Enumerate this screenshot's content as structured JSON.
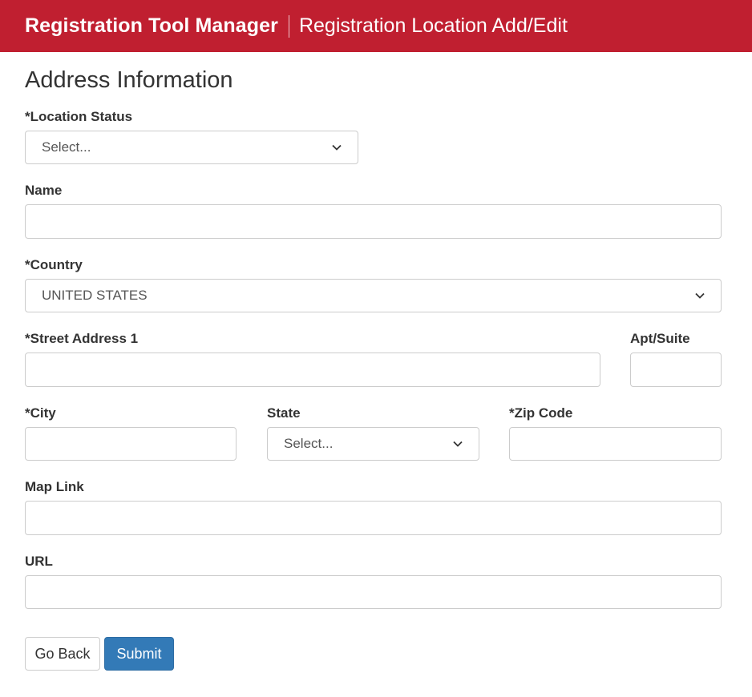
{
  "header": {
    "app_title": "Registration Tool Manager",
    "page_title": "Registration Location Add/Edit"
  },
  "form": {
    "section_title": "Address Information",
    "location_status": {
      "label": "*Location Status",
      "value": "Select..."
    },
    "name": {
      "label": "Name",
      "value": ""
    },
    "country": {
      "label": "*Country",
      "value": "UNITED STATES"
    },
    "street1": {
      "label": "*Street Address 1",
      "value": ""
    },
    "apt_suite": {
      "label": "Apt/Suite",
      "value": ""
    },
    "city": {
      "label": "*City",
      "value": ""
    },
    "state": {
      "label": "State",
      "value": "Select..."
    },
    "zip": {
      "label": "*Zip Code",
      "value": ""
    },
    "map_link": {
      "label": "Map Link",
      "value": ""
    },
    "url": {
      "label": "URL",
      "value": ""
    }
  },
  "actions": {
    "go_back": "Go Back",
    "submit": "Submit"
  },
  "colors": {
    "header_bg": "#c01f30",
    "primary_button": "#337ab7"
  }
}
